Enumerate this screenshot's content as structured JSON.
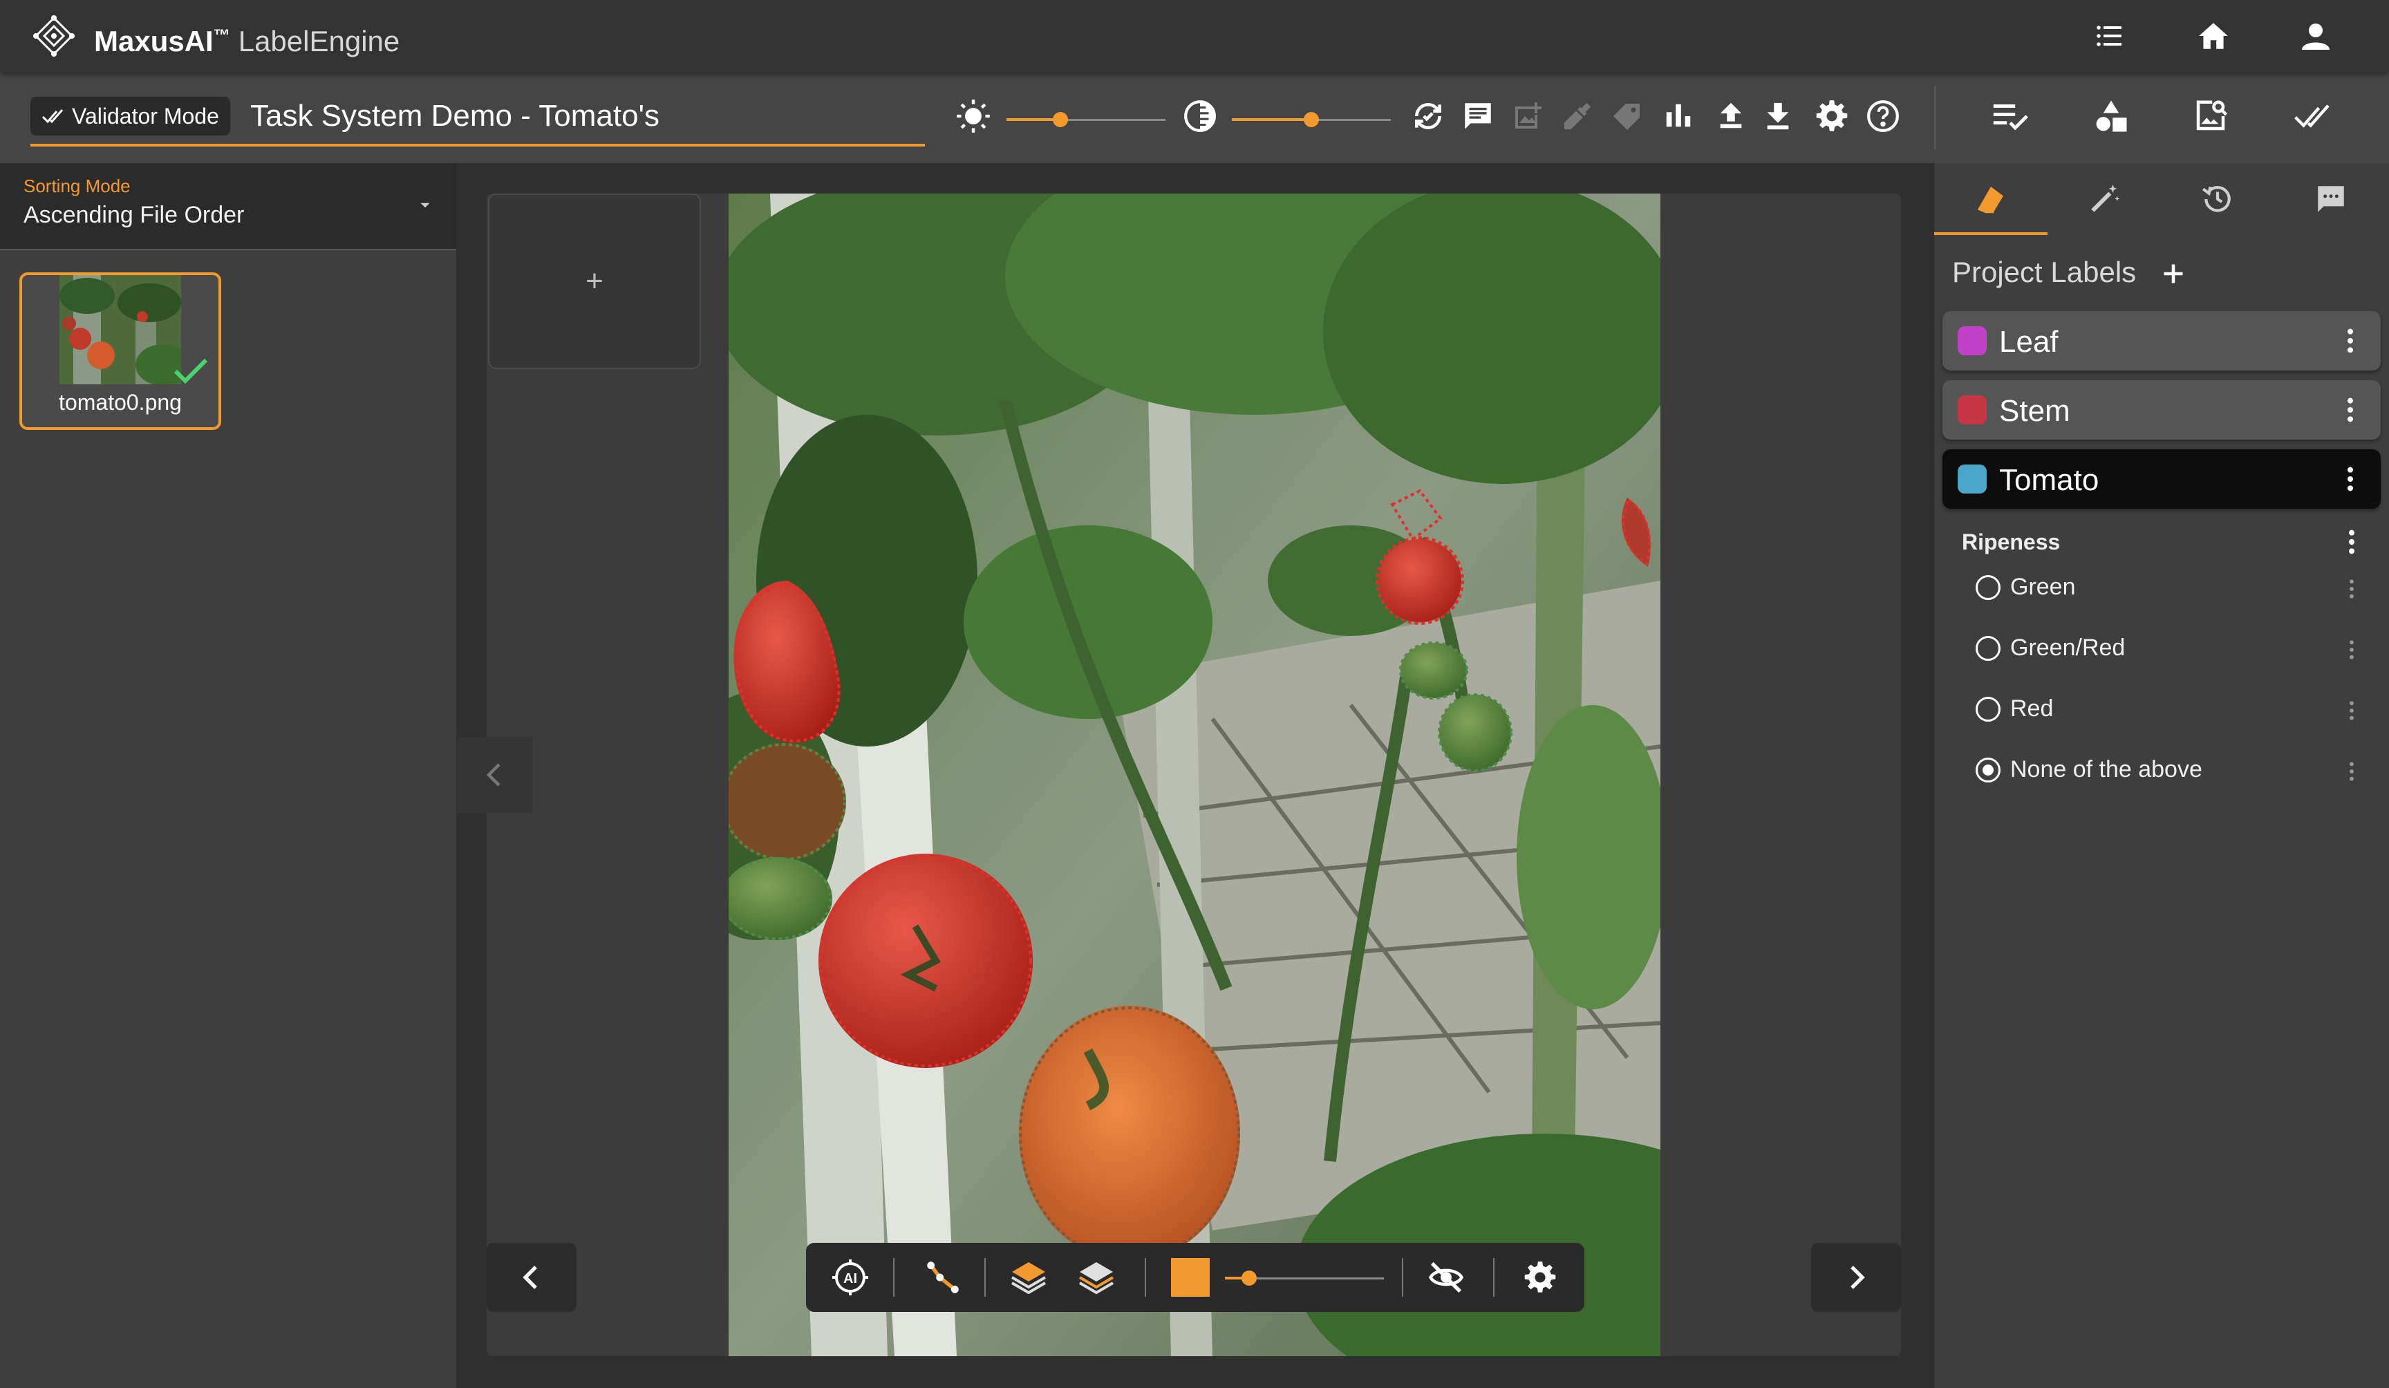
{
  "app": {
    "brand_name": "MaxusAI",
    "brand_tm": "™",
    "product_name": "LabelEngine"
  },
  "toolbar": {
    "mode_label": "Validator Mode",
    "task_title": "Task System Demo - Tomato's",
    "brightness_level": 0.34,
    "contrast_level": 0.5,
    "accent_color": "#f39a2e"
  },
  "left_panel": {
    "sorting_label": "Sorting Mode",
    "sorting_value": "Ascending File Order",
    "files": [
      {
        "name": "tomato0.png",
        "validated": true
      }
    ]
  },
  "viewer": {
    "add_symbol": "+",
    "opacity_level": 0.15
  },
  "right_panel": {
    "tabs": [
      "labels-tab",
      "magic-wand-tab",
      "history-tab",
      "comments-tab"
    ],
    "section_title": "Project Labels",
    "labels": [
      {
        "name": "Leaf",
        "color": "#c142c8",
        "selected": false
      },
      {
        "name": "Stem",
        "color": "#c73646",
        "selected": false
      },
      {
        "name": "Tomato",
        "color": "#4aa6c9",
        "selected": true
      }
    ],
    "attribute": {
      "title": "Ripeness",
      "options": [
        {
          "label": "Green",
          "checked": false
        },
        {
          "label": "Green/Red",
          "checked": false
        },
        {
          "label": "Red",
          "checked": false
        },
        {
          "label": "None of the above",
          "checked": true
        }
      ]
    }
  }
}
